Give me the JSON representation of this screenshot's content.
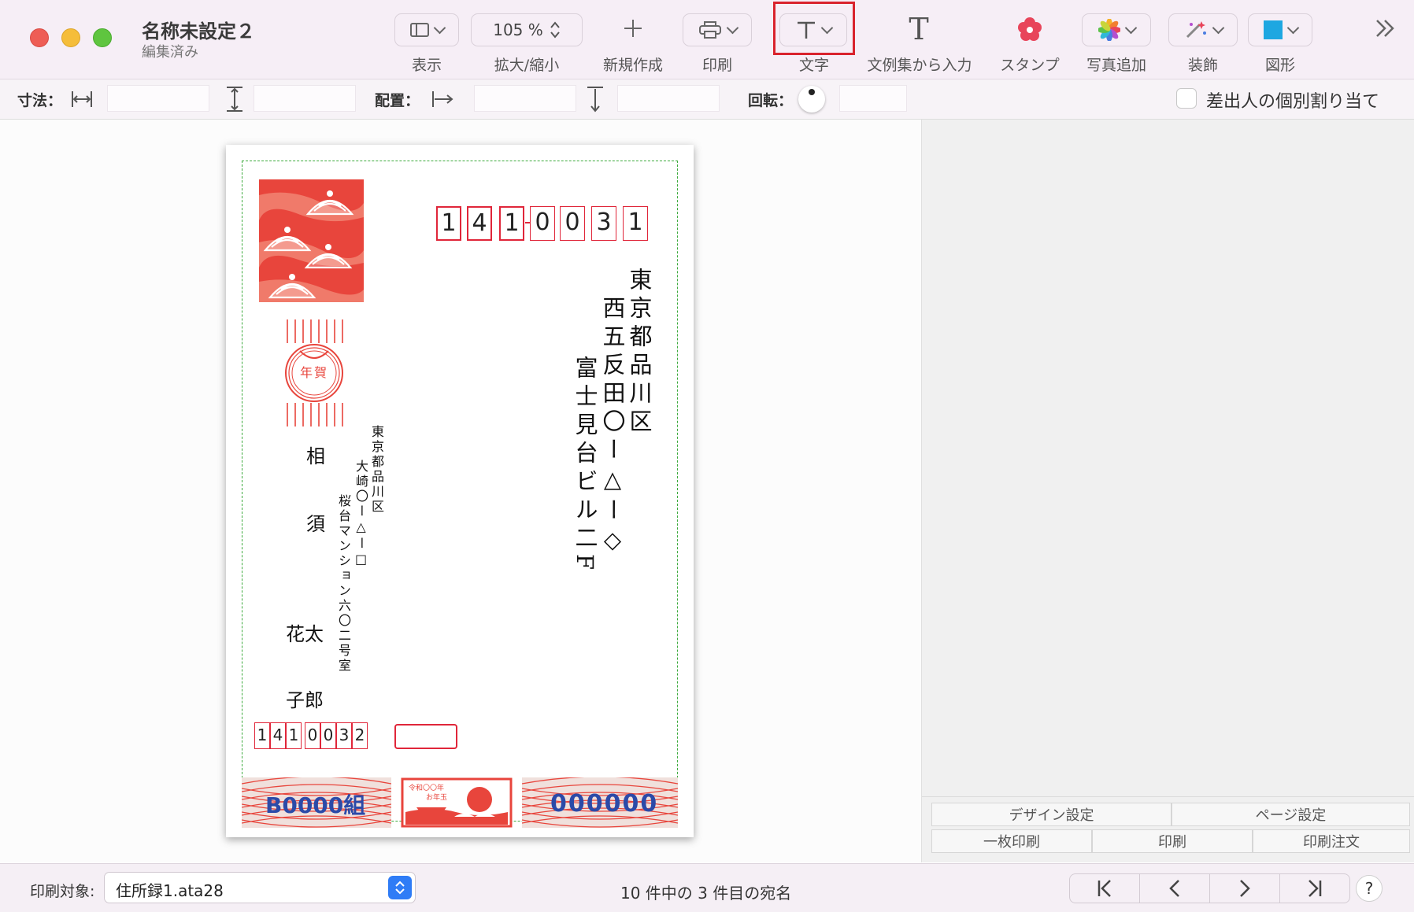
{
  "window": {
    "title": "名称未設定２",
    "subtitle": "編集済み"
  },
  "toolbar": {
    "view_label": "表示",
    "zoom_value": "105 %",
    "zoom_label": "拡大/縮小",
    "new_label": "新規作成",
    "print_label": "印刷",
    "text_label": "文字",
    "template_text_label": "文例集から入力",
    "stamp_label": "スタンプ",
    "photo_label": "写真追加",
    "decor_label": "装飾",
    "shape_label": "図形"
  },
  "toolbar2": {
    "size_label": "寸法：",
    "position_label": "配置：",
    "rotation_label": "回転：",
    "sender_checkbox_label": "差出人の個別割り当て"
  },
  "card": {
    "recipient_zip": [
      "1",
      "4",
      "1",
      "0",
      "0",
      "3",
      "1"
    ],
    "recipient_address_col1": "東京都品川区",
    "recipient_address_col2": "西五反田〇ー△ー◇",
    "recipient_address_col3": "富士見台ビル二F",
    "stamp_text": "年賀",
    "sender_address_col1": "東京都品川区",
    "sender_address_col2": "大崎〇ー△ー□",
    "sender_address_col3": "桜台マンション六〇二号室",
    "sender_name_1": "相",
    "sender_name_2": "須",
    "sender_name_3": "花太",
    "sender_name_4": "子郎",
    "sender_zip": [
      "1",
      "4",
      "1",
      "0",
      "0",
      "3",
      "2"
    ],
    "lottery_group": "B0000組",
    "lottery_number": "000000",
    "banner_small_1": "令和〇〇年",
    "banner_small_2": "お年玉"
  },
  "panel": {
    "design_settings": "デザイン設定",
    "page_settings": "ページ設定",
    "single_print": "一枚印刷",
    "print": "印刷",
    "print_order": "印刷注文"
  },
  "status": {
    "print_target_label": "印刷対象:",
    "print_target_value": "住所録1.ata28",
    "record_info": "10 件中の 3 件目の宛名",
    "help": "?"
  },
  "colors": {
    "accent_red": "#e0263a",
    "highlight_box": "#d9232d",
    "guide_green": "#3daa3d"
  }
}
